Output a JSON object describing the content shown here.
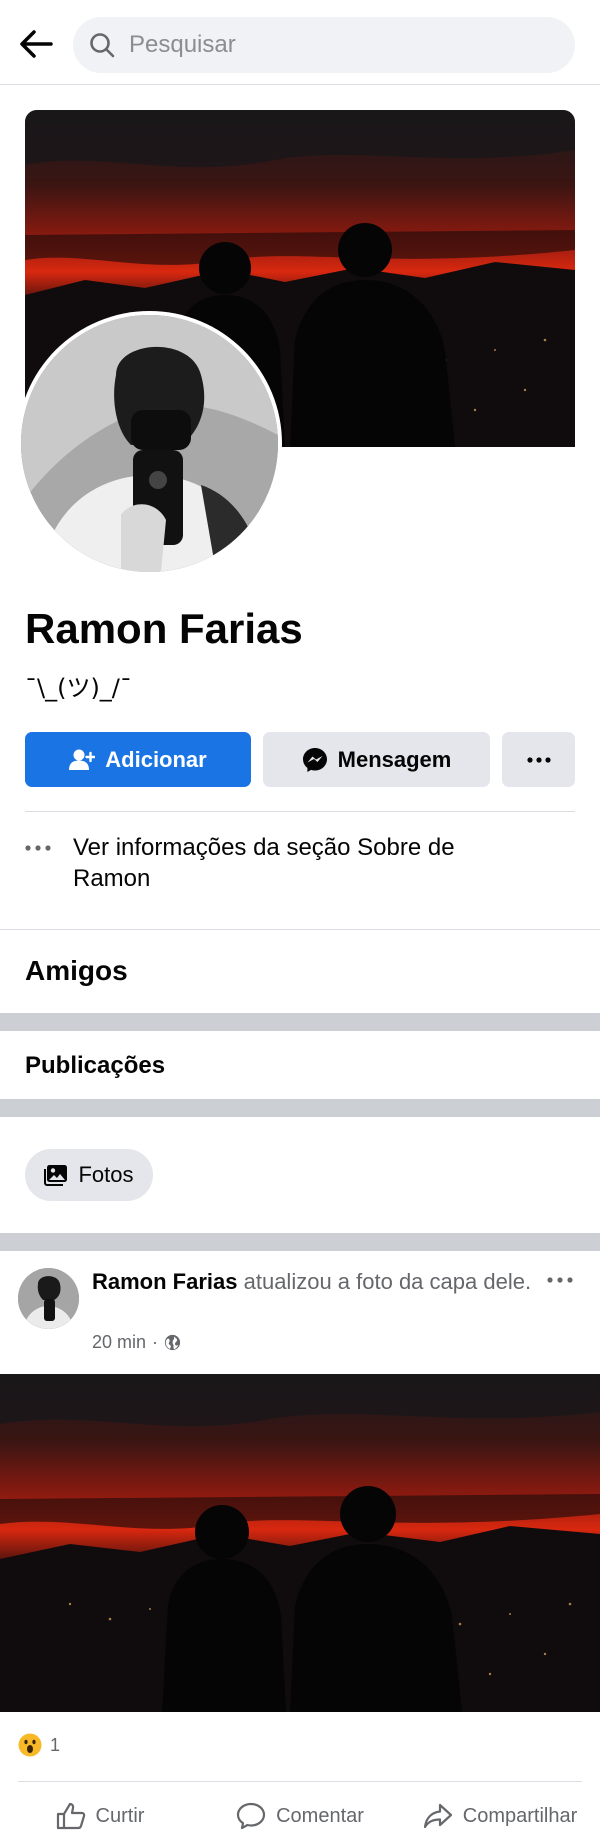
{
  "search": {
    "placeholder": "Pesquisar"
  },
  "profile": {
    "name": "Ramon Farias",
    "bio": "¯\\_(ツ)_/¯"
  },
  "actions": {
    "add_label": "Adicionar",
    "message_label": "Mensagem"
  },
  "about": {
    "text": "Ver informações da seção Sobre de Ramon"
  },
  "sections": {
    "friends": "Amigos",
    "posts": "Publicações",
    "photos_chip": "Fotos"
  },
  "post": {
    "author": "Ramon Farias",
    "action_text": " atualizou a foto da capa dele.",
    "time": "20 min",
    "separator": "·",
    "reaction_count": "1",
    "like_label": "Curtir",
    "comment_label": "Comentar",
    "share_label": "Compartilhar"
  },
  "colors": {
    "accent": "#1b74e4",
    "secondary_button": "#e4e6eb",
    "muted_text": "#65676b",
    "band": "#ccd0d5"
  },
  "icons": {
    "back": "arrow-left-icon",
    "search": "search-icon",
    "add_friend": "add-friend-icon",
    "messenger": "messenger-icon",
    "more": "more-icon",
    "photos": "photos-icon",
    "globe": "globe-icon",
    "wow": "wow-reaction-icon",
    "like": "like-icon",
    "comment": "comment-icon",
    "share": "share-icon"
  }
}
